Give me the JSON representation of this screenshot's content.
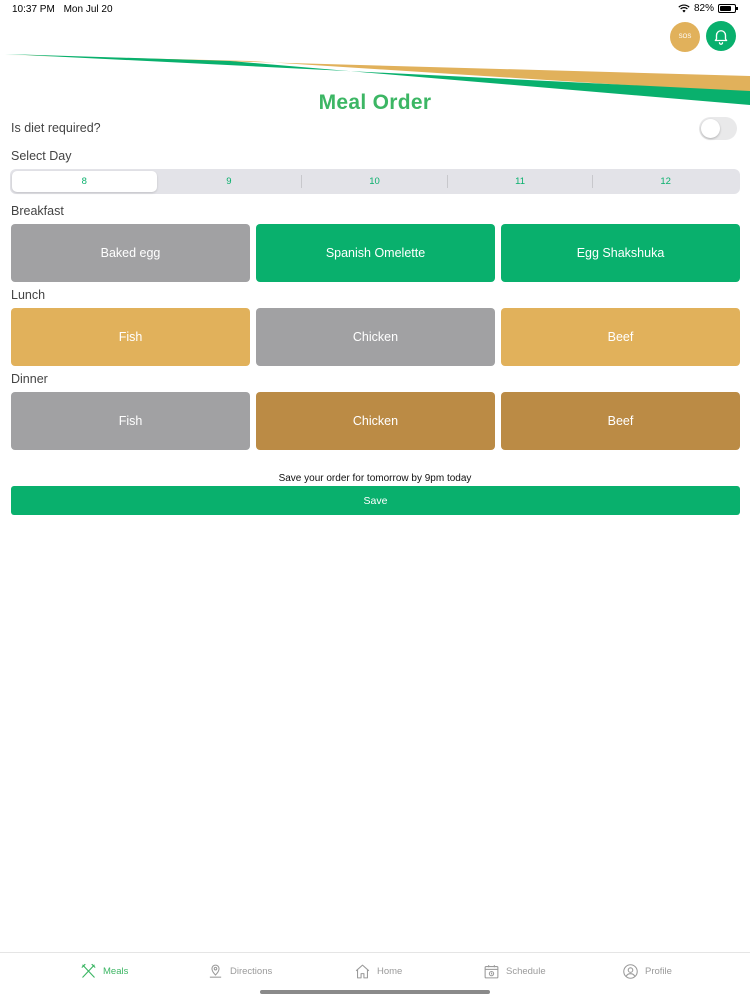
{
  "status_bar": {
    "time": "10:37 PM",
    "date": "Mon Jul 20",
    "battery": "82%",
    "battery_level": 0.82
  },
  "header": {
    "title": "Meal Order",
    "sos_label": "SOS",
    "colors": {
      "green": "#09b06d",
      "gold": "#e1b15b"
    }
  },
  "diet": {
    "label": "Is diet required?",
    "enabled": false
  },
  "day_select": {
    "label": "Select Day",
    "days": [
      "8",
      "9",
      "10",
      "11",
      "12"
    ],
    "selected": "8"
  },
  "breakfast": {
    "label": "Breakfast",
    "options": [
      {
        "name": "Baked egg",
        "color": "#a1a1a3"
      },
      {
        "name": "Spanish Omelette",
        "color": "#09b06d"
      },
      {
        "name": "Egg Shakshuka",
        "color": "#09b06d"
      }
    ]
  },
  "lunch": {
    "label": "Lunch",
    "options": [
      {
        "name": "Fish",
        "color": "#e1b15b"
      },
      {
        "name": "Chicken",
        "color": "#a1a1a3"
      },
      {
        "name": "Beef",
        "color": "#e1b15b"
      }
    ]
  },
  "dinner": {
    "label": "Dinner",
    "options": [
      {
        "name": "Fish",
        "color": "#a1a1a3"
      },
      {
        "name": "Chicken",
        "color": "#bb8b45"
      },
      {
        "name": "Beef",
        "color": "#bb8b45"
      }
    ]
  },
  "save": {
    "note": "Save your order for tomorrow by 9pm today",
    "button_label": "Save"
  },
  "tabs": [
    {
      "label": "Meals",
      "icon": "utensils-icon",
      "active": true
    },
    {
      "label": "Directions",
      "icon": "map-pin-icon",
      "active": false
    },
    {
      "label": "Home",
      "icon": "home-icon",
      "active": false
    },
    {
      "label": "Schedule",
      "icon": "calendar-icon",
      "active": false
    },
    {
      "label": "Profile",
      "icon": "user-icon",
      "active": false
    }
  ]
}
